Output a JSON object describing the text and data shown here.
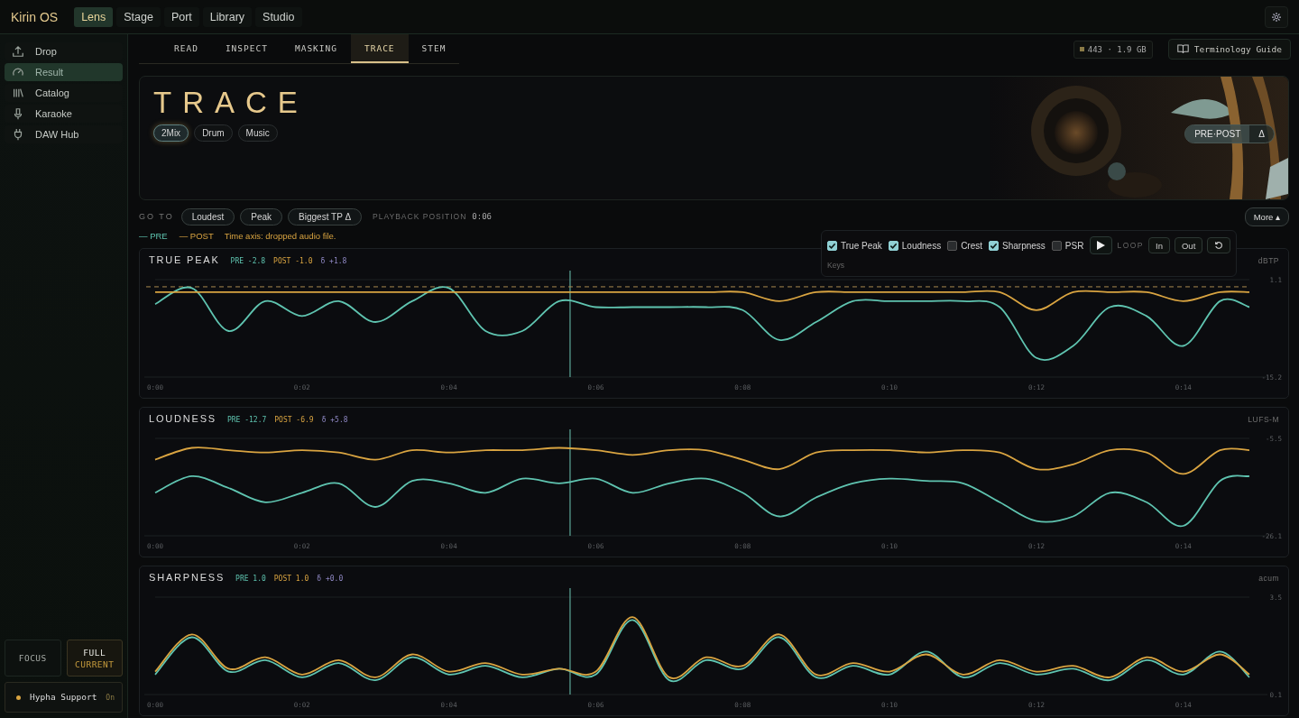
{
  "app": {
    "title": "Kirin OS",
    "gear": true
  },
  "nav_tabs": [
    {
      "label": "Lens",
      "selected": true
    },
    {
      "label": "Stage",
      "selected": false
    },
    {
      "label": "Port",
      "selected": false
    },
    {
      "label": "Library",
      "selected": false
    },
    {
      "label": "Studio",
      "selected": false
    }
  ],
  "sidebar": {
    "items": [
      {
        "label": "Drop",
        "selected": false
      },
      {
        "label": "Result",
        "selected": true
      },
      {
        "label": "Catalog",
        "selected": false
      },
      {
        "label": "Karaoke",
        "selected": false
      },
      {
        "label": "DAW Hub",
        "selected": false
      }
    ],
    "modes": [
      {
        "label": "FOCUS",
        "selected": false
      },
      {
        "label": "FULL",
        "sub": "CURRENT",
        "selected": true
      }
    ],
    "support": {
      "label": "Hypha Support",
      "state": "On",
      "on": true
    }
  },
  "sub_tabs": [
    {
      "label": "READ",
      "selected": false
    },
    {
      "label": "INSPECT",
      "selected": false
    },
    {
      "label": "MASKING",
      "selected": false
    },
    {
      "label": "TRACE",
      "selected": true
    },
    {
      "label": "STEM",
      "selected": false
    }
  ],
  "storage_chip": "443 · 1.9 GB",
  "guide_button": "Terminology Guide",
  "hero": {
    "title": "TRACE",
    "sources": [
      {
        "label": "2Mix",
        "selected": true
      },
      {
        "label": "Drum",
        "selected": false
      },
      {
        "label": "Music",
        "selected": false
      }
    ],
    "compare": [
      {
        "label": "PRE·POST",
        "selected": true
      },
      {
        "label": "Δ",
        "selected": false
      }
    ]
  },
  "goto": {
    "label": "GO TO",
    "buttons": [
      "Loudest",
      "Peak",
      "Biggest TP Δ"
    ],
    "position_label": "PLAYBACK POSITION",
    "position": "0:06",
    "more": "More ▴"
  },
  "legend": {
    "pre": "— PRE",
    "post": "— POST",
    "note": "Time axis: dropped audio file."
  },
  "keys_panel": {
    "checks": [
      {
        "label": "True Peak",
        "checked": true
      },
      {
        "label": "Loudness",
        "checked": true
      },
      {
        "label": "Crest",
        "checked": false
      },
      {
        "label": "Sharpness",
        "checked": true
      },
      {
        "label": "PSR",
        "checked": false
      }
    ],
    "loop_label": "LOOP",
    "loop_buttons": [
      "In",
      "Out"
    ],
    "caption": "Keys"
  },
  "panels": [
    {
      "pre": "-2.8",
      "post": "-1.0",
      "delta": "δ +1.8",
      "chart_data": {
        "type": "line",
        "title": "TRUE PEAK",
        "ylabel": "dBTP",
        "x": [
          0,
          0.5,
          1,
          1.5,
          2,
          2.5,
          3,
          3.5,
          4,
          4.5,
          5,
          5.5,
          6,
          6.5,
          7,
          7.5,
          8,
          8.5,
          9,
          9.5,
          10,
          10.5,
          11,
          11.5,
          12,
          12.5,
          13,
          13.5,
          14,
          14.5,
          14.9
        ],
        "xlim": [
          0,
          14.9
        ],
        "ylim": [
          -15.2,
          1.1
        ],
        "yticks": [
          1.1,
          -15.2
        ],
        "xticks": [
          {
            "value": 0,
            "label": "0:00"
          },
          {
            "value": 2,
            "label": "0:02"
          },
          {
            "value": 4,
            "label": "0:04"
          },
          {
            "value": 6,
            "label": "0:06"
          },
          {
            "value": 8,
            "label": "0:08"
          },
          {
            "value": 10,
            "label": "0:10"
          },
          {
            "value": 12,
            "label": "0:12"
          },
          {
            "value": 14,
            "label": "0:14"
          }
        ],
        "series": [
          {
            "name": "PRE",
            "color": "#5fc4b0",
            "values": [
              -3,
              -0.3,
              -7.5,
              -2.5,
              -5,
              -2.5,
              -6,
              -2.5,
              -0.3,
              -7.5,
              -7.5,
              -2.5,
              -3.5,
              -3.5,
              -3.5,
              -3.5,
              -4,
              -9,
              -6,
              -2.5,
              -2.5,
              -2.5,
              -2.5,
              -3.5,
              -12,
              -10,
              -3.5,
              -5,
              -10,
              -2.5,
              -3.5
            ]
          },
          {
            "name": "POST",
            "color": "#d9a441",
            "values": [
              -1,
              -1,
              -1,
              -1,
              -1,
              -1,
              -1,
              -1,
              -1,
              -1,
              -1,
              -1,
              -1,
              -1,
              -1,
              -1,
              -1,
              -2.5,
              -1,
              -1,
              -1,
              -1,
              -1,
              -1,
              -4,
              -1,
              -1,
              -1,
              -2.5,
              -1,
              -1
            ]
          }
        ],
        "ref_lines": [
          {
            "axis": "x",
            "value": 5.65
          },
          {
            "axis": "y",
            "value": -0.1
          }
        ]
      }
    },
    {
      "pre": "-12.7",
      "post": "-6.9",
      "delta": "δ +5.8",
      "chart_data": {
        "type": "line",
        "title": "LOUDNESS",
        "ylabel": "LUFS-M",
        "x": [
          0,
          0.5,
          1,
          1.5,
          2,
          2.5,
          3,
          3.5,
          4,
          4.5,
          5,
          5.5,
          6,
          6.5,
          7,
          7.5,
          8,
          8.5,
          9,
          9.5,
          10,
          10.5,
          11,
          11.5,
          12,
          12.5,
          13,
          13.5,
          14,
          14.5,
          14.9
        ],
        "xlim": [
          0,
          14.9
        ],
        "ylim": [
          -26.1,
          -5.5
        ],
        "yticks": [
          -5.5,
          -26.1
        ],
        "xticks": [
          {
            "value": 0,
            "label": "0:00"
          },
          {
            "value": 2,
            "label": "0:02"
          },
          {
            "value": 4,
            "label": "0:04"
          },
          {
            "value": 6,
            "label": "0:06"
          },
          {
            "value": 8,
            "label": "0:08"
          },
          {
            "value": 10,
            "label": "0:10"
          },
          {
            "value": 12,
            "label": "0:12"
          },
          {
            "value": 14,
            "label": "0:14"
          }
        ],
        "series": [
          {
            "name": "PRE",
            "color": "#5fc4b0",
            "values": [
              -17,
              -13.5,
              -16,
              -19,
              -17,
              -15,
              -20,
              -14.5,
              -15,
              -17,
              -14,
              -15,
              -14,
              -17,
              -15,
              -14,
              -17,
              -22,
              -18,
              -15,
              -14,
              -14.5,
              -15,
              -19,
              -23,
              -22,
              -17,
              -19,
              -24,
              -14.5,
              -13.5
            ]
          },
          {
            "name": "POST",
            "color": "#d9a441",
            "values": [
              -10,
              -7.5,
              -8,
              -8.5,
              -8,
              -8.5,
              -10,
              -8,
              -8.5,
              -8,
              -8,
              -7.5,
              -8,
              -9,
              -8,
              -8,
              -10,
              -12,
              -8.5,
              -8,
              -8,
              -8.5,
              -8,
              -8.5,
              -12,
              -11,
              -8,
              -8.5,
              -13,
              -8,
              -8
            ]
          }
        ],
        "ref_lines": [
          {
            "axis": "x",
            "value": 5.65
          }
        ]
      }
    },
    {
      "pre": "1.0",
      "post": "1.0",
      "delta": "δ +0.0",
      "chart_data": {
        "type": "line",
        "title": "SHARPNESS",
        "ylabel": "acum",
        "x": [
          0,
          0.5,
          1,
          1.5,
          2,
          2.5,
          3,
          3.5,
          4,
          4.5,
          5,
          5.5,
          6,
          6.5,
          7,
          7.5,
          8,
          8.5,
          9,
          9.5,
          10,
          10.5,
          11,
          11.5,
          12,
          12.5,
          13,
          13.5,
          14,
          14.5,
          14.9
        ],
        "xlim": [
          0,
          14.9
        ],
        "ylim": [
          0.1,
          3.5
        ],
        "yticks": [
          3.5,
          0.1
        ],
        "xticks": [
          {
            "value": 0,
            "label": "0:00"
          },
          {
            "value": 2,
            "label": "0:02"
          },
          {
            "value": 4,
            "label": "0:04"
          },
          {
            "value": 6,
            "label": "0:06"
          },
          {
            "value": 8,
            "label": "0:08"
          },
          {
            "value": 10,
            "label": "0:10"
          },
          {
            "value": 12,
            "label": "0:12"
          },
          {
            "value": 14,
            "label": "0:14"
          }
        ],
        "series": [
          {
            "name": "PRE",
            "color": "#5fc4b0",
            "values": [
              0.8,
              2.1,
              0.9,
              1.3,
              0.7,
              1.2,
              0.6,
              1.4,
              0.8,
              1.1,
              0.7,
              1.0,
              0.8,
              2.7,
              0.6,
              1.3,
              1.0,
              2.1,
              0.7,
              1.1,
              0.8,
              1.6,
              0.7,
              1.2,
              0.8,
              1.0,
              0.6,
              1.3,
              0.8,
              1.6,
              0.7
            ]
          },
          {
            "name": "POST",
            "color": "#d9a441",
            "values": [
              0.9,
              2.2,
              1.0,
              1.4,
              0.8,
              1.3,
              0.7,
              1.5,
              0.9,
              1.2,
              0.8,
              1.0,
              0.9,
              2.8,
              0.7,
              1.4,
              1.1,
              2.2,
              0.8,
              1.2,
              0.9,
              1.5,
              0.8,
              1.3,
              0.9,
              1.1,
              0.7,
              1.4,
              0.9,
              1.5,
              0.8
            ]
          }
        ],
        "ref_lines": [
          {
            "axis": "x",
            "value": 5.65
          }
        ]
      }
    }
  ]
}
